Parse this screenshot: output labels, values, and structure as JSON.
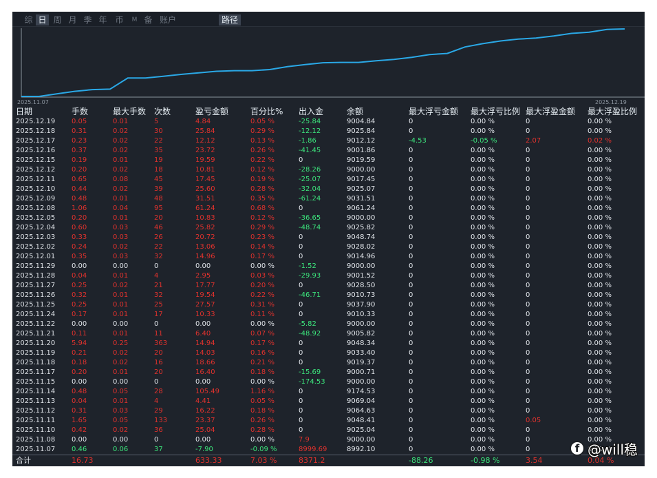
{
  "tabs": [
    {
      "label": "综",
      "active": false
    },
    {
      "label": "日",
      "active": true
    },
    {
      "label": "周",
      "active": false
    },
    {
      "label": "月",
      "active": false
    },
    {
      "label": "季",
      "active": false
    },
    {
      "label": "年",
      "active": false
    },
    {
      "label": "币",
      "active": false
    },
    {
      "label": "M",
      "active": false
    },
    {
      "label": "备",
      "active": false
    },
    {
      "label": "账户",
      "active": false
    }
  ],
  "route_button": "路径",
  "colors": {
    "line": "#2aa8e6",
    "profit": "#e0322d",
    "loss": "#3ce57c",
    "neutral": "#dfe3e8"
  },
  "chart_data": {
    "type": "line",
    "x_start_label": "2025.11.07",
    "x_end_label": "2025.12.19",
    "x": [
      "2025.11.07",
      "2025.11.08",
      "2025.11.10",
      "2025.11.11",
      "2025.11.12",
      "2025.11.13",
      "2025.11.14",
      "2025.11.15",
      "2025.11.17",
      "2025.11.18",
      "2025.11.19",
      "2025.11.20",
      "2025.11.21",
      "2025.11.22",
      "2025.11.24",
      "2025.11.25",
      "2025.11.26",
      "2025.11.27",
      "2025.11.28",
      "2025.11.29",
      "2025.12.01",
      "2025.12.02",
      "2025.12.03",
      "2025.12.04",
      "2025.12.05",
      "2025.12.08",
      "2025.12.09",
      "2025.12.10",
      "2025.12.11",
      "2025.12.12",
      "2025.12.15",
      "2025.12.16",
      "2025.12.17",
      "2025.12.18",
      "2025.12.19"
    ],
    "y": [
      -7.9,
      -7.9,
      17.14,
      40.51,
      56.73,
      61.14,
      166.63,
      166.63,
      183.03,
      201.69,
      215.72,
      230.66,
      237.06,
      237.06,
      247.39,
      274.96,
      294.5,
      312.27,
      315.22,
      315.22,
      330.18,
      343.24,
      363.96,
      389.78,
      400.61,
      461.85,
      493.36,
      518.96,
      536.41,
      547.22,
      566.81,
      590.53,
      602.65,
      628.49,
      633.33
    ],
    "xlabel": "",
    "ylabel": ""
  },
  "columns": [
    "日期",
    "手数",
    "最大手数",
    "次数",
    "盈亏金额",
    "百分比%",
    "出入金",
    "余额",
    "最大浮亏金额",
    "最大浮亏比例",
    "最大浮盈金额",
    "最大浮盈比例"
  ],
  "rows": [
    [
      "2025.12.19",
      "0.05",
      "0.01",
      "5",
      "4.84",
      "0.05 %",
      "-25.84",
      "9004.84",
      "0",
      "0.00 %",
      "0",
      "0.00 %"
    ],
    [
      "2025.12.18",
      "0.31",
      "0.02",
      "30",
      "25.84",
      "0.29 %",
      "-12.12",
      "9025.84",
      "0",
      "0.00 %",
      "0",
      "0.00 %"
    ],
    [
      "2025.12.17",
      "0.23",
      "0.02",
      "22",
      "12.12",
      "0.13 %",
      "-1.86",
      "9012.12",
      "-4.53",
      "-0.05 %",
      "2.07",
      "0.02 %"
    ],
    [
      "2025.12.16",
      "0.37",
      "0.02",
      "35",
      "23.72",
      "0.26 %",
      "-41.45",
      "9001.86",
      "0",
      "0.00 %",
      "0",
      "0.00 %"
    ],
    [
      "2025.12.15",
      "0.19",
      "0.01",
      "19",
      "19.59",
      "0.22 %",
      "0",
      "9019.59",
      "0",
      "0.00 %",
      "0",
      "0.00 %"
    ],
    [
      "2025.12.12",
      "0.20",
      "0.02",
      "18",
      "10.81",
      "0.12 %",
      "-28.26",
      "9000.00",
      "0",
      "0.00 %",
      "0",
      "0.00 %"
    ],
    [
      "2025.12.11",
      "0.65",
      "0.08",
      "45",
      "17.45",
      "0.19 %",
      "-25.07",
      "9017.45",
      "0",
      "0.00 %",
      "0",
      "0.00 %"
    ],
    [
      "2025.12.10",
      "0.44",
      "0.02",
      "39",
      "25.60",
      "0.28 %",
      "-32.04",
      "9025.07",
      "0",
      "0.00 %",
      "0",
      "0.00 %"
    ],
    [
      "2025.12.09",
      "0.48",
      "0.01",
      "48",
      "31.51",
      "0.35 %",
      "-61.24",
      "9031.51",
      "0",
      "0.00 %",
      "0",
      "0.00 %"
    ],
    [
      "2025.12.08",
      "1.06",
      "0.04",
      "95",
      "61.24",
      "0.68 %",
      "0",
      "9061.24",
      "0",
      "0.00 %",
      "0",
      "0.00 %"
    ],
    [
      "2025.12.05",
      "0.20",
      "0.01",
      "20",
      "10.83",
      "0.12 %",
      "-36.65",
      "9000.00",
      "0",
      "0.00 %",
      "0",
      "0.00 %"
    ],
    [
      "2025.12.04",
      "0.60",
      "0.03",
      "46",
      "25.82",
      "0.29 %",
      "-48.74",
      "9025.82",
      "0",
      "0.00 %",
      "0",
      "0.00 %"
    ],
    [
      "2025.12.03",
      "0.33",
      "0.03",
      "26",
      "20.72",
      "0.23 %",
      "0",
      "9048.74",
      "0",
      "0.00 %",
      "0",
      "0.00 %"
    ],
    [
      "2025.12.02",
      "0.24",
      "0.02",
      "22",
      "13.06",
      "0.14 %",
      "0",
      "9028.02",
      "0",
      "0.00 %",
      "0",
      "0.00 %"
    ],
    [
      "2025.12.01",
      "0.35",
      "0.03",
      "32",
      "14.96",
      "0.17 %",
      "0",
      "9014.96",
      "0",
      "0.00 %",
      "0",
      "0.00 %"
    ],
    [
      "2025.11.29",
      "0.00",
      "0.00",
      "0",
      "0.00",
      "0.00 %",
      "-1.52",
      "9000.00",
      "0",
      "0.00 %",
      "0",
      "0.00 %"
    ],
    [
      "2025.11.28",
      "0.04",
      "0.01",
      "4",
      "2.95",
      "0.03 %",
      "-29.93",
      "9001.52",
      "0",
      "0.00 %",
      "0",
      "0.00 %"
    ],
    [
      "2025.11.27",
      "0.25",
      "0.02",
      "21",
      "17.77",
      "0.20 %",
      "0",
      "9028.50",
      "0",
      "0.00 %",
      "0",
      "0.00 %"
    ],
    [
      "2025.11.26",
      "0.32",
      "0.01",
      "32",
      "19.54",
      "0.22 %",
      "-46.71",
      "9010.73",
      "0",
      "0.00 %",
      "0",
      "0.00 %"
    ],
    [
      "2025.11.25",
      "0.25",
      "0.01",
      "25",
      "27.57",
      "0.31 %",
      "0",
      "9037.90",
      "0",
      "0.00 %",
      "0",
      "0.00 %"
    ],
    [
      "2025.11.24",
      "0.17",
      "0.01",
      "17",
      "10.33",
      "0.11 %",
      "0",
      "9010.33",
      "0",
      "0.00 %",
      "0",
      "0.00 %"
    ],
    [
      "2025.11.22",
      "0.00",
      "0.00",
      "0",
      "0.00",
      "0.00 %",
      "-5.82",
      "9000.00",
      "0",
      "0.00 %",
      "0",
      "0.00 %"
    ],
    [
      "2025.11.21",
      "0.11",
      "0.01",
      "11",
      "6.40",
      "0.07 %",
      "-48.92",
      "9005.82",
      "0",
      "0.00 %",
      "0",
      "0.00 %"
    ],
    [
      "2025.11.20",
      "5.94",
      "0.25",
      "363",
      "14.94",
      "0.17 %",
      "0",
      "9048.34",
      "0",
      "0.00 %",
      "0",
      "0.00 %"
    ],
    [
      "2025.11.19",
      "0.21",
      "0.02",
      "20",
      "14.03",
      "0.16 %",
      "0",
      "9033.40",
      "0",
      "0.00 %",
      "0",
      "0.00 %"
    ],
    [
      "2025.11.18",
      "0.18",
      "0.02",
      "16",
      "18.66",
      "0.21 %",
      "0",
      "9019.37",
      "0",
      "0.00 %",
      "0",
      "0.00 %"
    ],
    [
      "2025.11.17",
      "0.20",
      "0.01",
      "20",
      "16.40",
      "0.18 %",
      "-15.69",
      "9000.71",
      "0",
      "0.00 %",
      "0",
      "0.00 %"
    ],
    [
      "2025.11.15",
      "0.00",
      "0.00",
      "0",
      "0.00",
      "0.00 %",
      "-174.53",
      "9000.00",
      "0",
      "0.00 %",
      "0",
      "0.00 %"
    ],
    [
      "2025.11.14",
      "0.48",
      "0.05",
      "28",
      "105.49",
      "1.16 %",
      "0",
      "9174.53",
      "0",
      "0.00 %",
      "0",
      "0.00 %"
    ],
    [
      "2025.11.13",
      "0.04",
      "0.01",
      "4",
      "4.41",
      "0.05 %",
      "0",
      "9069.04",
      "0",
      "0.00 %",
      "0",
      "0.00 %"
    ],
    [
      "2025.11.12",
      "0.31",
      "0.03",
      "29",
      "16.22",
      "0.18 %",
      "0",
      "9064.63",
      "0",
      "0.00 %",
      "0",
      "0.00 %"
    ],
    [
      "2025.11.11",
      "1.65",
      "0.05",
      "133",
      "23.37",
      "0.26 %",
      "0",
      "9048.41",
      "0",
      "0.00 %",
      "0.05",
      "0.00 %"
    ],
    [
      "2025.11.10",
      "0.42",
      "0.02",
      "36",
      "25.04",
      "0.28 %",
      "0",
      "9025.04",
      "0",
      "0.00 %",
      "0",
      "0.00 %"
    ],
    [
      "2025.11.08",
      "0.00",
      "0.00",
      "0",
      "0.00",
      "0.00 %",
      "7.9",
      "9000.00",
      "0",
      "0.00 %",
      "0",
      "0.00 %"
    ],
    [
      "2025.11.07",
      "0.46",
      "0.06",
      "37",
      "-7.90",
      "-0.09 %",
      "8999.69",
      "8992.10",
      "0",
      "0.00 %",
      "0",
      "0.00 %"
    ]
  ],
  "totals": {
    "label": "合计",
    "lots": "16.73",
    "pnl": "633.33",
    "pct": "7.03 %",
    "flow": "8371.2",
    "max_float_loss": "-88.26",
    "max_float_loss_pct": "-0.98 %",
    "max_float_profit": "3.54",
    "max_float_profit_pct": "0.04 %"
  },
  "watermark": {
    "logo_glyph": "f",
    "text": "@will稳"
  }
}
